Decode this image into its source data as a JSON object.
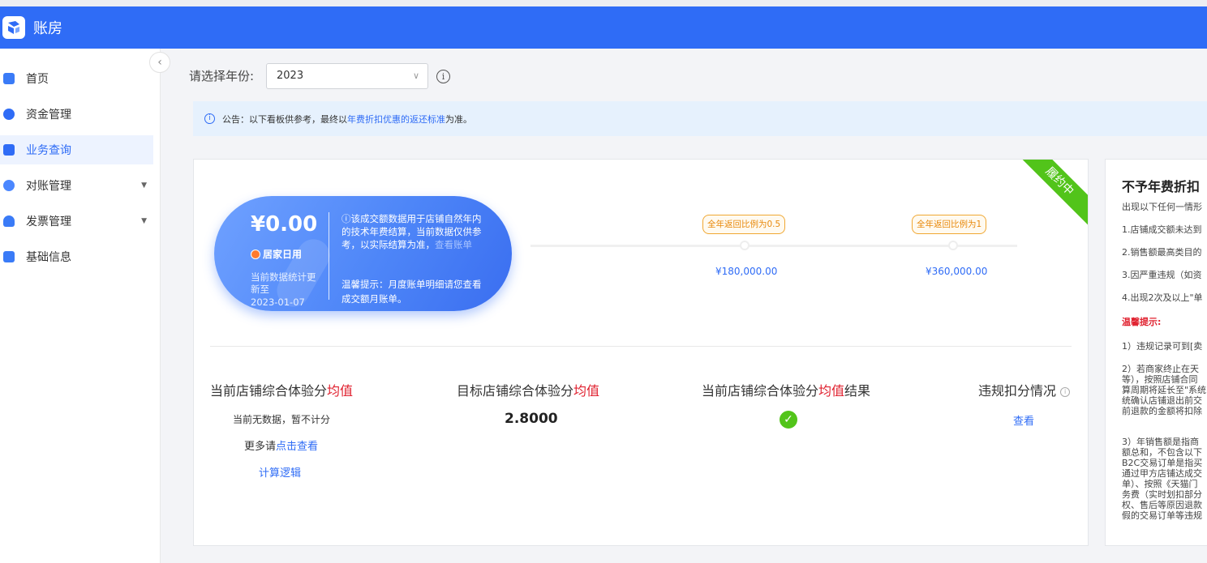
{
  "app": {
    "title": "账房"
  },
  "sidebar": {
    "items": [
      {
        "label": "首页",
        "color": "#3a7bf7",
        "active": false
      },
      {
        "label": "资金管理",
        "color": "#2f6cf6",
        "active": false
      },
      {
        "label": "业务查询",
        "color": "#2f6cf6",
        "active": true
      },
      {
        "label": "对账管理",
        "color": "#4b87ff",
        "active": false,
        "expandable": true
      },
      {
        "label": "发票管理",
        "color": "#3a7bf7",
        "active": false,
        "expandable": true
      },
      {
        "label": "基础信息",
        "color": "#3a7bf7",
        "active": false
      }
    ]
  },
  "filter": {
    "label": "请选择年份:",
    "year": "2023"
  },
  "notice": {
    "prefix": "公告：以下看板供参考，最终以",
    "link": "年费折扣优惠的返还标准",
    "suffix": "为准。"
  },
  "summary": {
    "ribbon": "履约中",
    "amount": "¥0.00",
    "category": "居家日用",
    "update_label": "当前数据统计更新至",
    "update_date": "2023-01-07",
    "note1_text": "ⓘ该成交额数据用于店铺自然年内的技术年费结算，当前数据仅供参考，以实际结算为准，",
    "note1_link": "查看账单",
    "note2": "温馨提示：月度账单明细请您查看成交额月账单。",
    "milestones": [
      {
        "tip": "全年返回比例为0.5",
        "value": "¥180,000.00"
      },
      {
        "tip": "全年返回比例为1",
        "value": "¥360,000.00"
      }
    ]
  },
  "stats": {
    "current": {
      "title_a": "当前店铺综合体验分",
      "title_b": "均值",
      "line1": "当前无数据，暂不计分",
      "line2_a": "更多请",
      "line2_link": "点击查看",
      "calc_link": "计算逻辑"
    },
    "target": {
      "title_a": "目标店铺综合体验分",
      "title_b": "均值",
      "value": "2.8000"
    },
    "result": {
      "title_a": "当前店铺综合体验分",
      "title_b": "均值",
      "title_c": "结果"
    },
    "violation": {
      "title": "违规扣分情况",
      "link": "查看"
    }
  },
  "side": {
    "title": "不予年费折扣",
    "intro": "出现以下任何一情形",
    "rules": [
      "1.店铺成交额未达到",
      "2.销售额最高类目的",
      "3.因严重违规（如资",
      "4.出现2次及以上\"单"
    ],
    "tip_title": "温馨提示:",
    "tips": [
      [
        "1）违规记录可到[卖"
      ],
      [
        "2）若商家终止在天",
        "等），按照店铺合同",
        "算周期将延长至\"系统",
        "统确认店铺退出前交",
        "前退款的金额将扣除"
      ],
      [
        "3）年销售额是指商",
        "额总和，不包含以下",
        "B2C交易订单是指买",
        "通过甲方店铺达成交",
        "单）、按照《天猫门",
        "务费（实时划扣部分",
        "权、售后等原因退款",
        "假的交易订单等违规"
      ]
    ]
  }
}
